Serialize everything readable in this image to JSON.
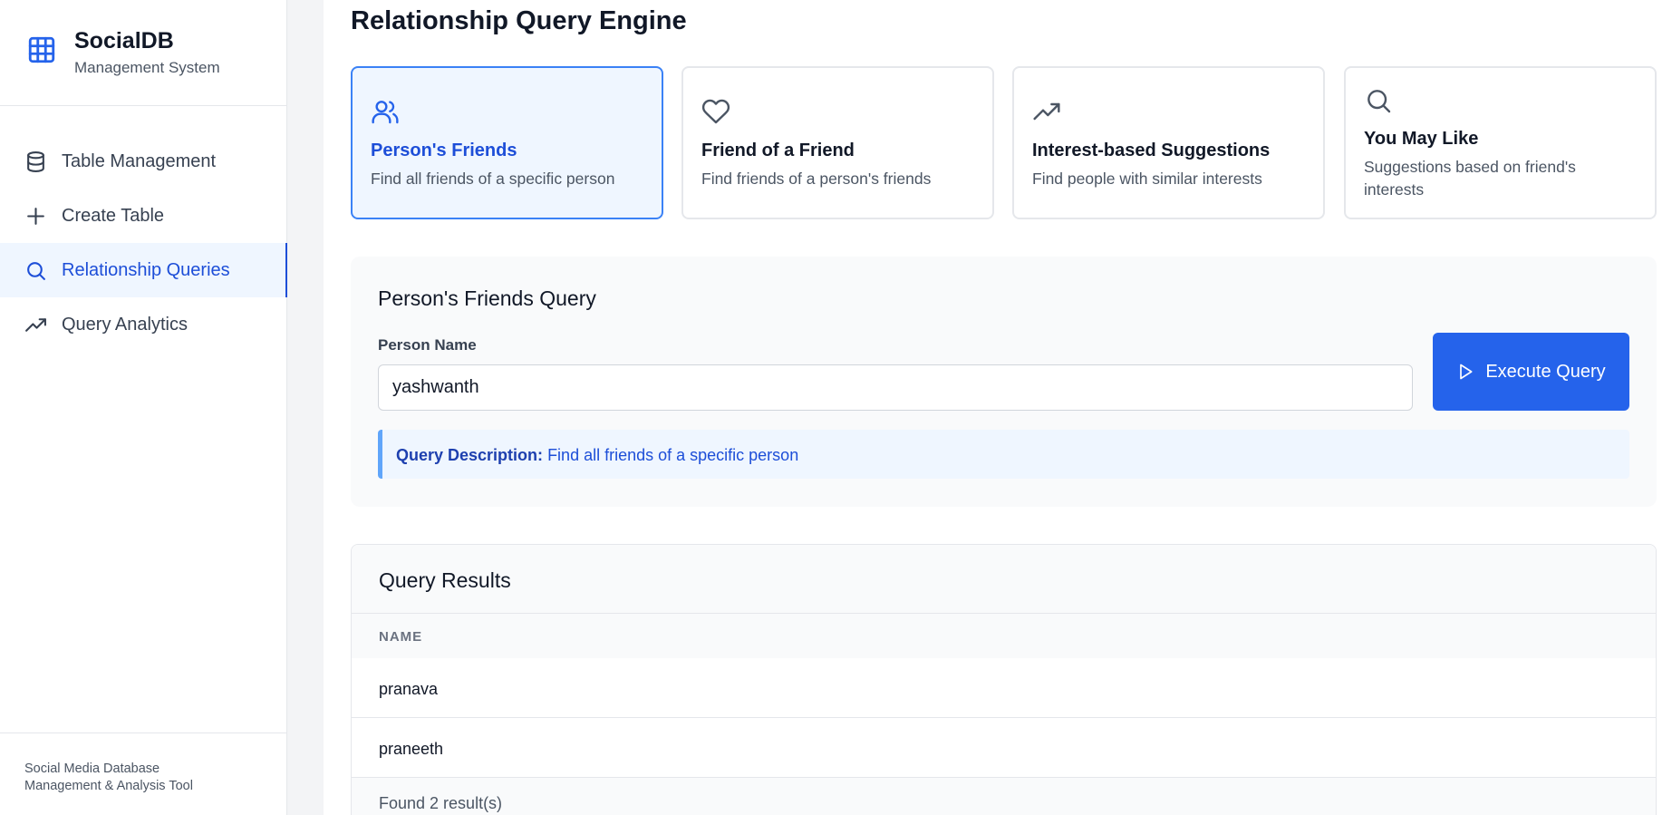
{
  "brand": {
    "title": "SocialDB",
    "subtitle": "Management System",
    "icon": "table-grid-icon"
  },
  "nav": {
    "items": [
      {
        "label": "Table Management",
        "icon": "database-icon"
      },
      {
        "label": "Create Table",
        "icon": "plus-icon"
      },
      {
        "label": "Relationship Queries",
        "icon": "search-icon",
        "active": true
      },
      {
        "label": "Query Analytics",
        "icon": "trending-up-icon"
      }
    ]
  },
  "footer": {
    "line1": "Social Media Database",
    "line2": "Management & Analysis Tool"
  },
  "page": {
    "title": "Relationship Query Engine"
  },
  "query_types": [
    {
      "title": "Person's Friends",
      "description": "Find all friends of a specific person",
      "icon": "users-icon",
      "active": true
    },
    {
      "title": "Friend of a Friend",
      "description": "Find friends of a person's friends",
      "icon": "heart-icon"
    },
    {
      "title": "Interest-based Suggestions",
      "description": "Find people with similar interests",
      "icon": "trending-up-icon"
    },
    {
      "title": "You May Like",
      "description": "Suggestions based on friend's interests",
      "icon": "search-icon"
    }
  ],
  "query_form": {
    "title": "Person's Friends Query",
    "field_label": "Person Name",
    "field_value": "yashwanth",
    "execute_label": "Execute Query",
    "description_label": "Query Description:",
    "description_text": "Find all friends of a specific person"
  },
  "results": {
    "title": "Query Results",
    "column": "NAME",
    "rows": [
      "pranava",
      "praneeth"
    ],
    "summary": "Found 2 result(s)"
  },
  "colors": {
    "accent": "#2563eb",
    "active_bg": "#eff6ff",
    "active_text": "#1d4ed8"
  }
}
